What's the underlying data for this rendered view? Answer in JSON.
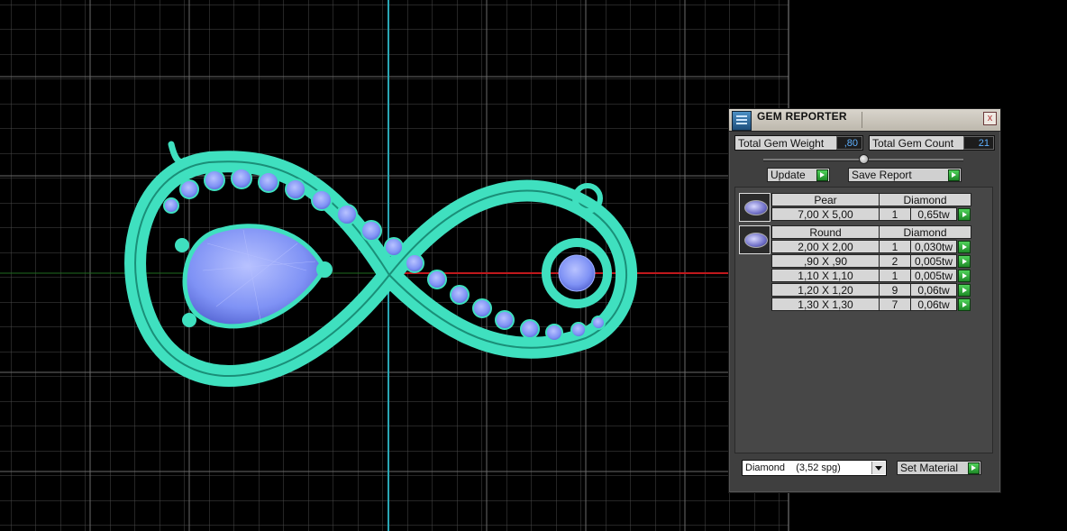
{
  "panel": {
    "title": "GEM REPORTER",
    "close_label": "x",
    "total_gem_weight_label": "Total Gem Weight",
    "total_gem_weight_value": ",80",
    "total_gem_count_label": "Total Gem Count",
    "total_gem_count_value": "21",
    "update_label": "Update",
    "save_report_label": "Save Report",
    "groups": [
      {
        "shape": "Pear",
        "material": "Diamond",
        "rows": [
          {
            "size": "7,00 X 5,00",
            "count": "1",
            "weight": "0,65tw"
          }
        ]
      },
      {
        "shape": "Round",
        "material": "Diamond",
        "rows": [
          {
            "size": "2,00 X 2,00",
            "count": "1",
            "weight": "0,030tw"
          },
          {
            "size": ",90 X ,90",
            "count": "2",
            "weight": "0,005tw"
          },
          {
            "size": "1,10 X 1,10",
            "count": "1",
            "weight": "0,005tw"
          },
          {
            "size": "1,20 X 1,20",
            "count": "9",
            "weight": "0,06tw"
          },
          {
            "size": "1,30 X 1,30",
            "count": "7",
            "weight": "0,06tw"
          }
        ]
      }
    ],
    "material_select_value": "Diamond    (3,52 spg)",
    "set_material_label": "Set Material"
  },
  "icons": {
    "app": "gem-reporter-icon",
    "close": "close-icon",
    "go": "green-arrow-icon",
    "dropdown": "chevron-down-icon",
    "gem_thumb": "gem-thumbnail-icon"
  },
  "colors": {
    "model": "#3fe0bf",
    "gem": "#7f92f5",
    "grid": "#5a5a5a",
    "axis_vertical": "#2aa7b5",
    "axis_horizontal": "#c0181c",
    "panel_bg": "#3f3f3f",
    "value_text": "#5fb1ff",
    "go_button": "#2ea837"
  }
}
